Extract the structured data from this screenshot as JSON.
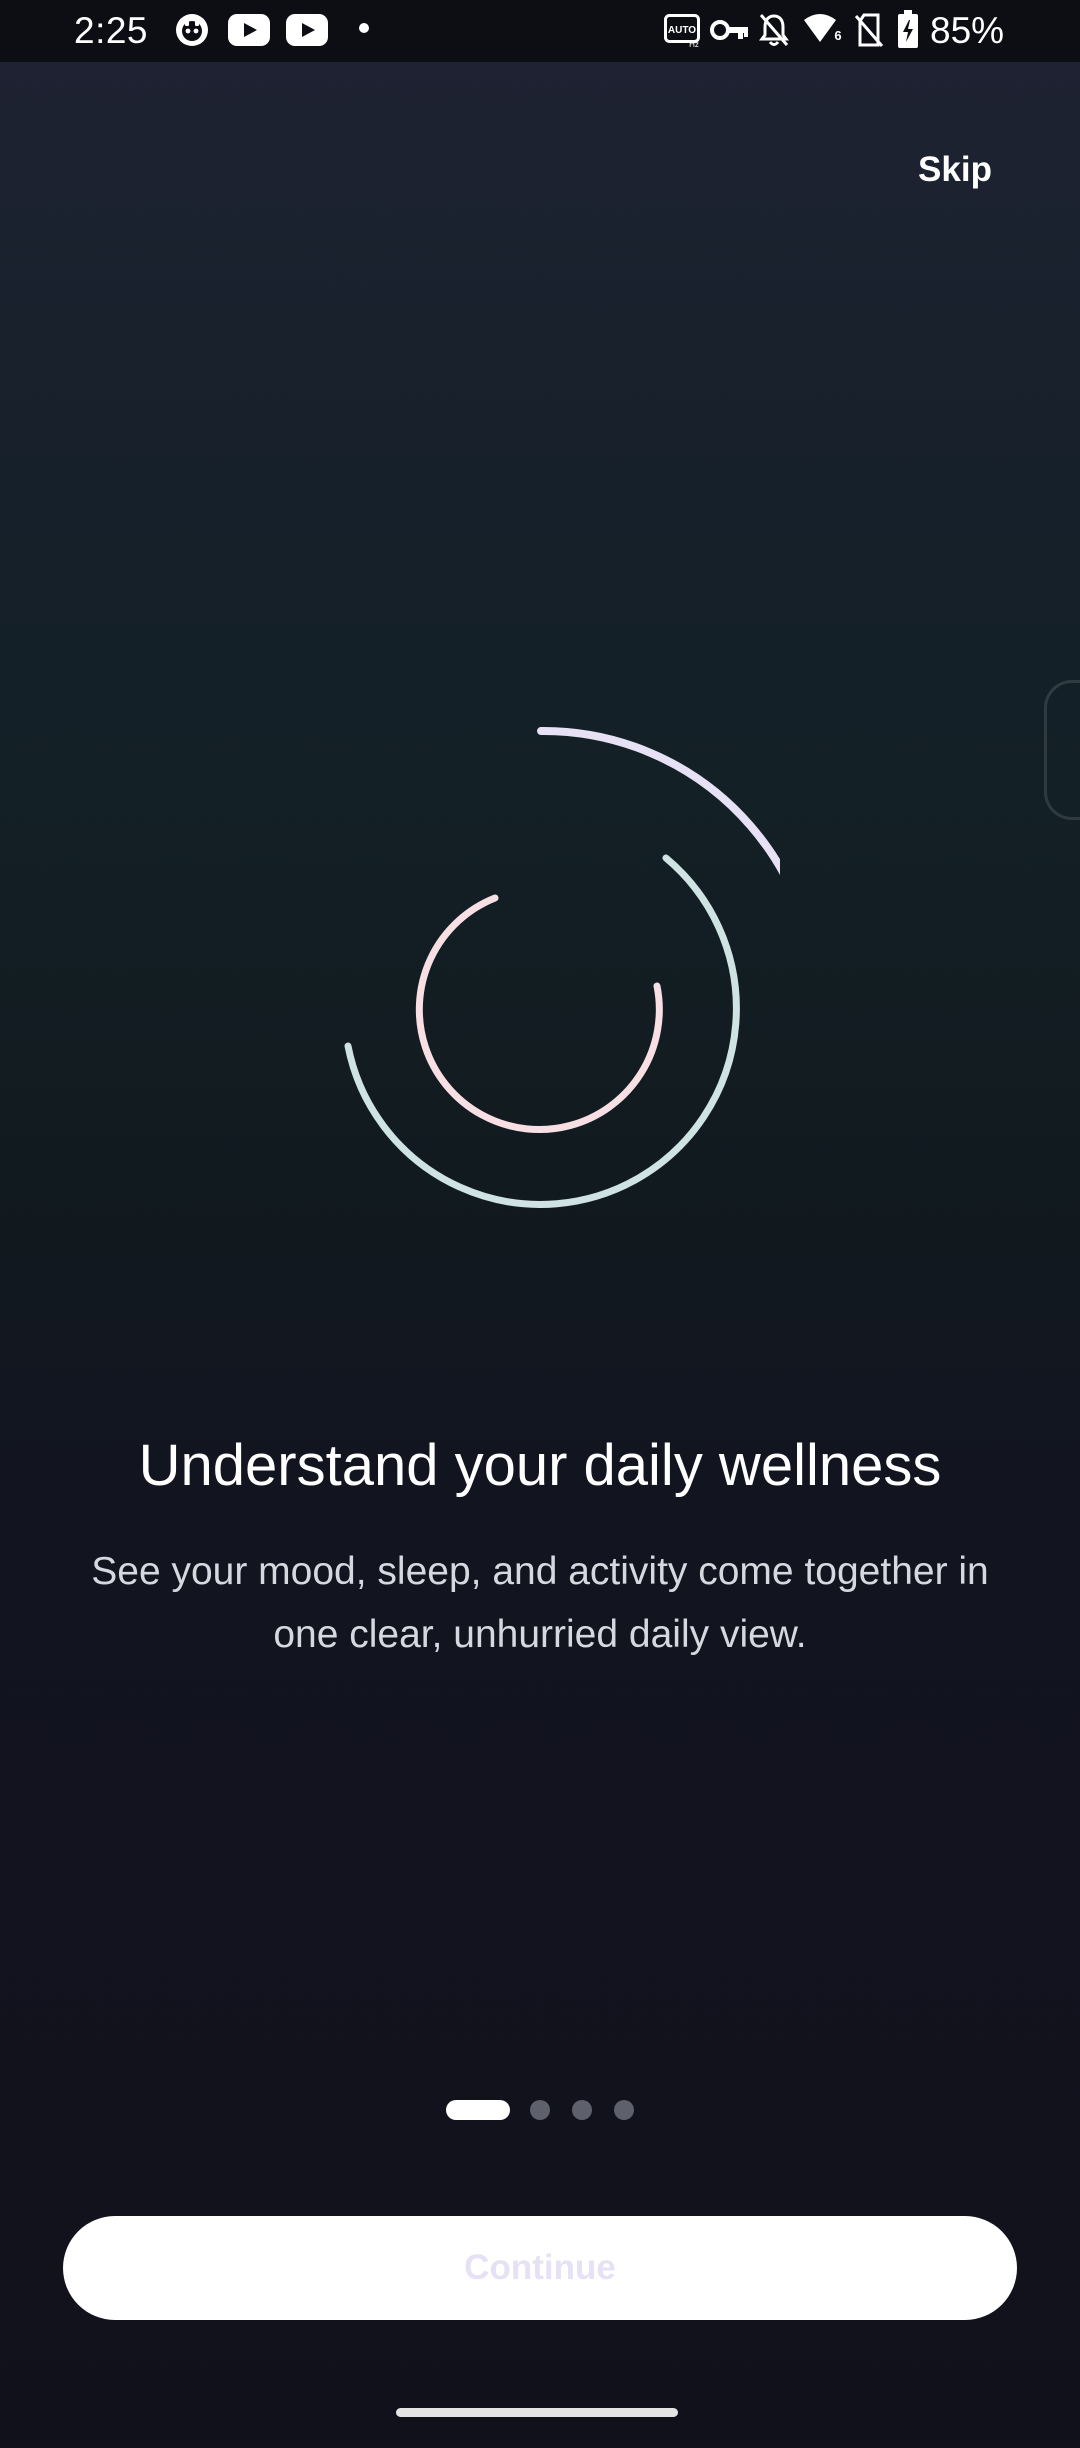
{
  "status_bar": {
    "time": "2:25",
    "battery_percent": "85%",
    "icons": [
      "game-controller-icon",
      "youtube-icon",
      "youtube-icon",
      "notification-dot-icon",
      "auto-hz-icon",
      "vpn-key-icon",
      "notifications-off-icon",
      "wifi-icon",
      "no-sim-icon",
      "battery-charging-icon"
    ]
  },
  "header": {
    "skip_label": "Skip"
  },
  "onboarding": {
    "title": "Understand your daily wellness",
    "description": "See your mood, sleep, and activity come together in one clear, unhurried daily view.",
    "page_count": 4,
    "current_page": 1
  },
  "footer": {
    "continue_label": "Continue"
  },
  "colors": {
    "background_top": "#1f2333",
    "background_mid": "#132026",
    "background_bottom": "#11111b",
    "outer_arc": "#e6e1f4",
    "middle_arc": "#cfe3e3",
    "inner_arc": "#f7dfe3",
    "button_bg": "#ffffff",
    "button_text": "#e6e1f4"
  }
}
